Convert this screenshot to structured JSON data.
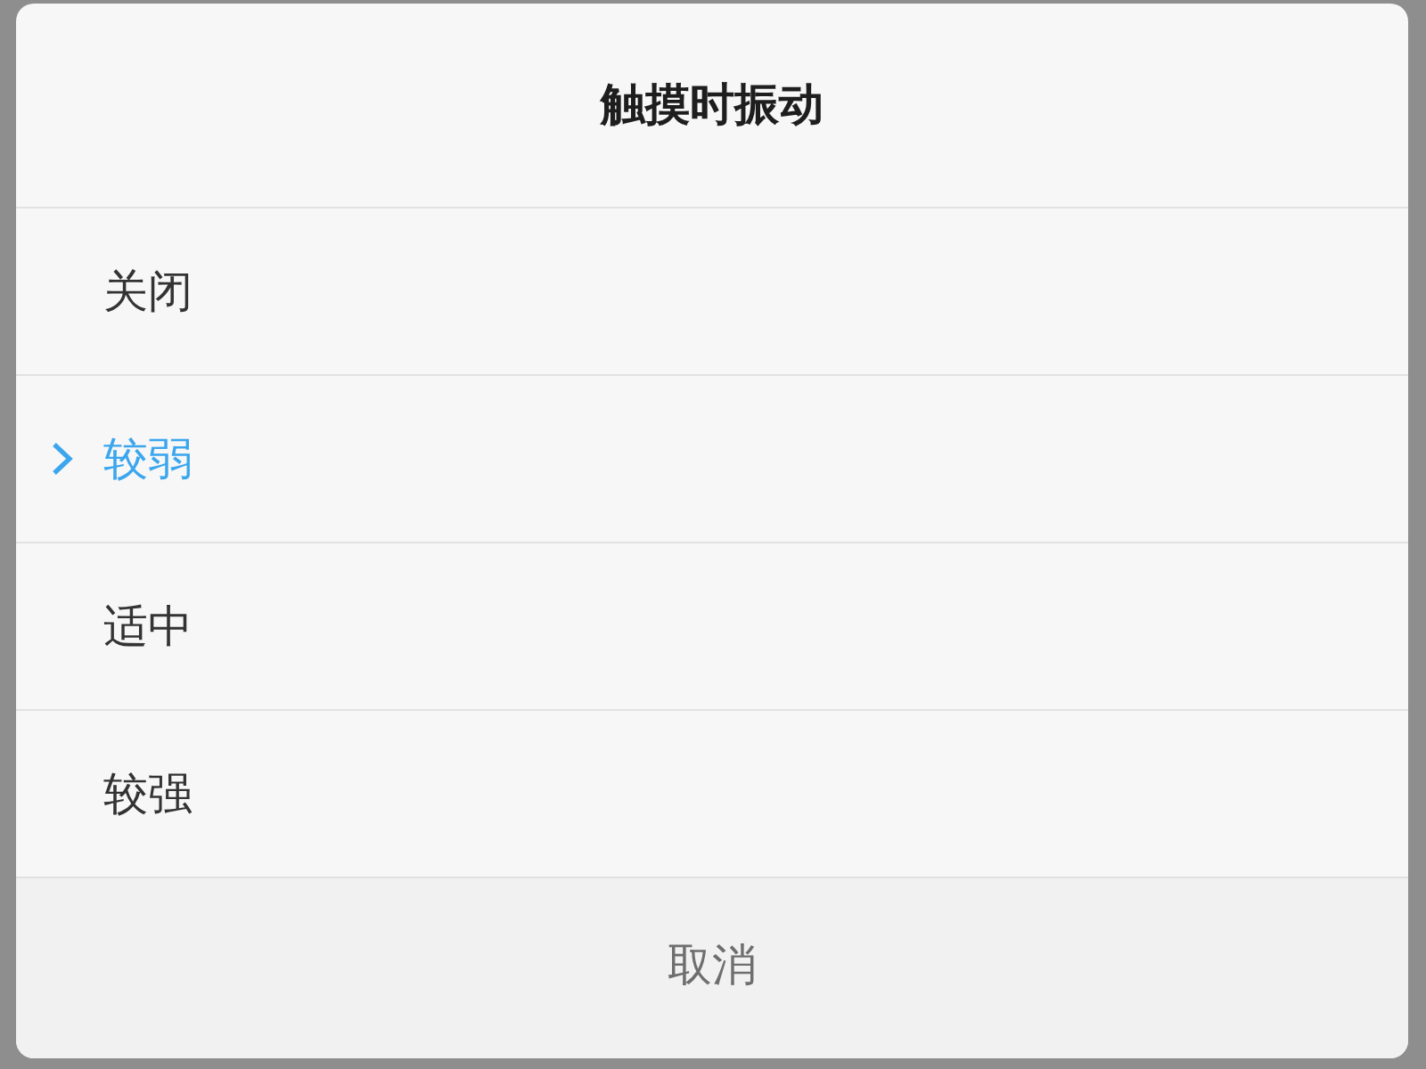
{
  "dialog": {
    "title": "触摸时振动",
    "options": [
      {
        "label": "关闭",
        "selected": false
      },
      {
        "label": "较弱",
        "selected": true
      },
      {
        "label": "适中",
        "selected": false
      },
      {
        "label": "较强",
        "selected": false
      }
    ],
    "cancel_button": "取消"
  }
}
